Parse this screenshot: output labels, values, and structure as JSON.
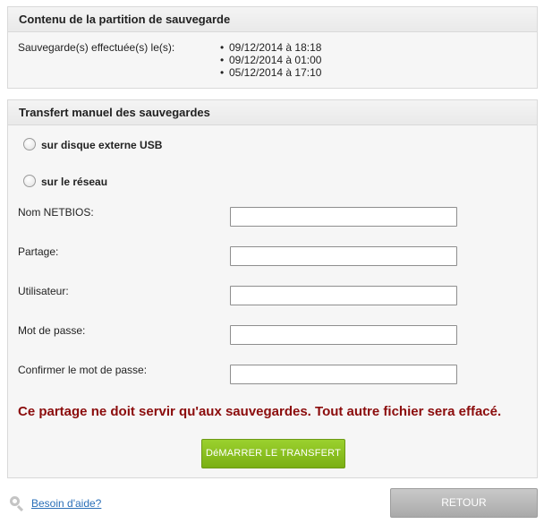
{
  "backup_contents": {
    "title": "Contenu de la partition de sauvegarde",
    "label": "Sauvegarde(s) effectuée(s) le(s):",
    "dates": [
      "09/12/2014 à 18:18",
      "09/12/2014 à 01:00",
      "05/12/2014 à 17:10"
    ]
  },
  "transfer": {
    "title": "Transfert manuel des sauvegardes",
    "options": {
      "usb": {
        "label": "sur disque externe USB",
        "selected": false
      },
      "network": {
        "label": "sur le réseau",
        "selected": false
      }
    },
    "fields": {
      "netbios": {
        "label": "Nom NETBIOS:",
        "value": ""
      },
      "share": {
        "label": "Partage:",
        "value": ""
      },
      "user": {
        "label": "Utilisateur:",
        "value": ""
      },
      "password": {
        "label": "Mot de passe:",
        "value": ""
      },
      "confirm": {
        "label": "Confirmer le mot de passe:",
        "value": ""
      }
    },
    "warning": "Ce partage ne doit servir qu'aux sauvegardes. Tout autre fichier sera effacé.",
    "start_button": "DéMARRER LE TRANSFERT"
  },
  "footer": {
    "help_link": "Besoin d'aide?",
    "help_icon": "search-icon",
    "back_button": "RETOUR"
  },
  "colors": {
    "warning": "#8b0c0c",
    "start_button": "#8cc11f",
    "back_button": "#b9b9b9",
    "link": "#2a6fb8"
  }
}
